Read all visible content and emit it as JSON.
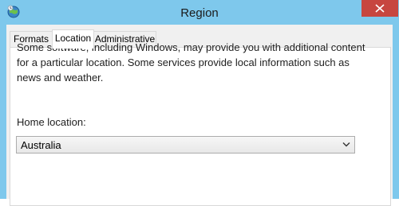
{
  "window": {
    "title": "Region",
    "icon": "region-globe-icon",
    "close_icon": "close-icon"
  },
  "tabs": [
    {
      "label": "Formats",
      "selected": false
    },
    {
      "label": "Location",
      "selected": true
    },
    {
      "label": "Administrative",
      "selected": false
    }
  ],
  "location": {
    "description": "Some software, including Windows, may provide you with additional content for a particular location. Some services provide local information such as news and weather.",
    "home_label": "Home location:",
    "home_value": "Australia"
  },
  "colors": {
    "frame": "#7ec8ec",
    "close": "#c7463f"
  }
}
